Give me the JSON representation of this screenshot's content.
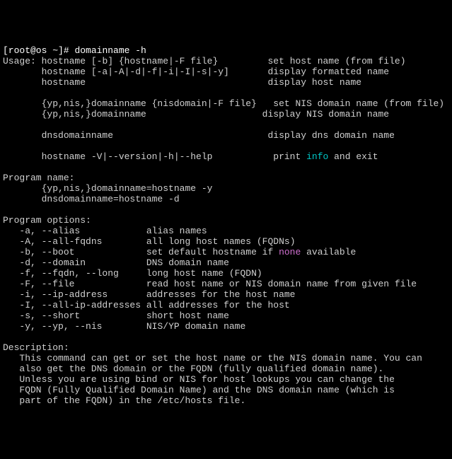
{
  "prompt": {
    "userhost": "[root@os ~]#",
    "cmd": "domainname -h"
  },
  "usage": {
    "label": "Usage:",
    "l1a": "hostname [-b] {hostname|-F file}",
    "l1b": "set host name (from file)",
    "l2a": "hostname [-a|-A|-d|-f|-i|-I|-s|-y]",
    "l2b": "display formatted name",
    "l3a": "hostname",
    "l3b": "display host name",
    "l4a": "{yp,nis,}domainname {nisdomain|-F file}",
    "l4b": "set NIS domain name (from file)",
    "l5a": "{yp,nis,}domainname",
    "l5b": "display NIS domain name",
    "l6a": "dnsdomainname",
    "l6b": "display dns domain name",
    "l7a": "hostname -V|--version|-h|--help",
    "l7b_pre": "print ",
    "l7b_kw": "info",
    "l7b_post": " and exit"
  },
  "progname": {
    "label": "Program name:",
    "l1": "{yp,nis,}domainname=hostname -y",
    "l2": "dnsdomainname=hostname -d"
  },
  "opts": {
    "label": "Program options:",
    "a": {
      "f": "-a, --alias",
      "d": "alias names"
    },
    "A": {
      "f": "-A, --all-fqdns",
      "d": "all long host names (FQDNs)"
    },
    "b": {
      "f": "-b, --boot",
      "d_pre": "set default hostname if ",
      "d_kw": "none",
      "d_post": " available"
    },
    "d": {
      "f": "-d, --domain",
      "d": "DNS domain name"
    },
    "f": {
      "f": "-f, --fqdn, --long",
      "d": "long host name (FQDN)"
    },
    "F": {
      "f": "-F, --file",
      "d": "read host name or NIS domain name from given file"
    },
    "i": {
      "f": "-i, --ip-address",
      "d": "addresses for the host name"
    },
    "I": {
      "f": "-I, --all-ip-addresses",
      "d": "all addresses for the host"
    },
    "s": {
      "f": "-s, --short",
      "d": "short host name"
    },
    "y": {
      "f": "-y, --yp, --nis",
      "d": "NIS/YP domain name"
    }
  },
  "desc": {
    "label": "Description:",
    "l1": "This command can get or set the host name or the NIS domain name. You can",
    "l2": "also get the DNS domain or the FQDN (fully qualified domain name).",
    "l3": "Unless you are using bind or NIS for host lookups you can change the",
    "l4": "FQDN (Fully Qualified Domain Name) and the DNS domain name (which is",
    "l5": "part of the FQDN) in the /etc/hosts file."
  }
}
